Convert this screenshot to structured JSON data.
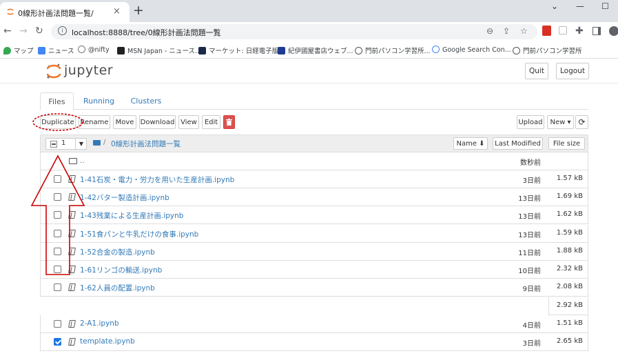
{
  "browser": {
    "tab_title": "0線形計画法問題一覧/",
    "tab_close": "×",
    "new_tab": "+",
    "url": "localhost:8888/tree/0線形計画法問題一覧",
    "back": "←",
    "forward": "→",
    "reload": "↻",
    "minimize": "—",
    "maximize": "☐",
    "bookmarks": [
      {
        "label": "マップ",
        "color": "#34a853"
      },
      {
        "label": "ニュース",
        "color": "#4285f4"
      },
      {
        "label": "@nifty",
        "color": "#ffffff"
      },
      {
        "label": "MSN Japan - ニュース...",
        "color": "#222222"
      },
      {
        "label": "マーケット: 日経電子版",
        "color": "#1b2a4a"
      },
      {
        "label": "紀伊國屋書店ウェブ...",
        "color": "#1f3a93"
      },
      {
        "label": "門前パソコン学習所...",
        "color": "#555555"
      },
      {
        "label": "Google Search Con...",
        "color": "#ffffff"
      },
      {
        "label": "門前パソコン学習所",
        "color": "#555555"
      }
    ]
  },
  "header": {
    "logo_text": "jupyter",
    "quit": "Quit",
    "logout": "Logout"
  },
  "tabs": [
    "Files",
    "Running",
    "Clusters"
  ],
  "toolbar": {
    "duplicate": "Duplicate",
    "rename": "Rename",
    "move": "Move",
    "download": "Download",
    "view": "View",
    "edit": "Edit",
    "upload": "Upload",
    "new": "New ▾",
    "refresh": "⟳"
  },
  "list_header": {
    "selected_count": "1",
    "sep": "/",
    "folder": "0線形計画法問題一覧",
    "sort_name": "Name ⬇",
    "sort_modified": "Last Modified",
    "sort_size": "File size"
  },
  "parent": {
    "name": "..",
    "modified": "数秒前"
  },
  "files": [
    {
      "name": "1-41石炭・電力・労力を用いた生産計画.ipynb",
      "modified": "3日前",
      "size": "1.57 kB",
      "checked": false
    },
    {
      "name": "1-42バター製造計画.ipynb",
      "modified": "13日前",
      "size": "1.69 kB",
      "checked": false
    },
    {
      "name": "1-43残業による生産計画.ipynb",
      "modified": "13日前",
      "size": "1.62 kB",
      "checked": false
    },
    {
      "name": "1-51食パンと牛乳だけの食事.ipynb",
      "modified": "13日前",
      "size": "1.59 kB",
      "checked": false
    },
    {
      "name": "1-52合金の製造.ipynb",
      "modified": "11日前",
      "size": "1.88 kB",
      "checked": false
    },
    {
      "name": "1-61リンゴの輸送.ipynb",
      "modified": "10日前",
      "size": "2.32 kB",
      "checked": false
    },
    {
      "name": "1-62人員の配置.ipynb",
      "modified": "9日前",
      "size": "2.08 kB",
      "checked": false
    }
  ],
  "gap_size": "2.92 kB",
  "files_after": [
    {
      "name": "2-A1.ipynb",
      "modified": "4日前",
      "size": "1.51 kB",
      "checked": false
    },
    {
      "name": "template.ipynb",
      "modified": "3日前",
      "size": "2.65 kB",
      "checked": true
    }
  ],
  "colors": {
    "annotation": "#cc0000",
    "link": "#337ab7",
    "jupyter_orange": "#f37726"
  }
}
